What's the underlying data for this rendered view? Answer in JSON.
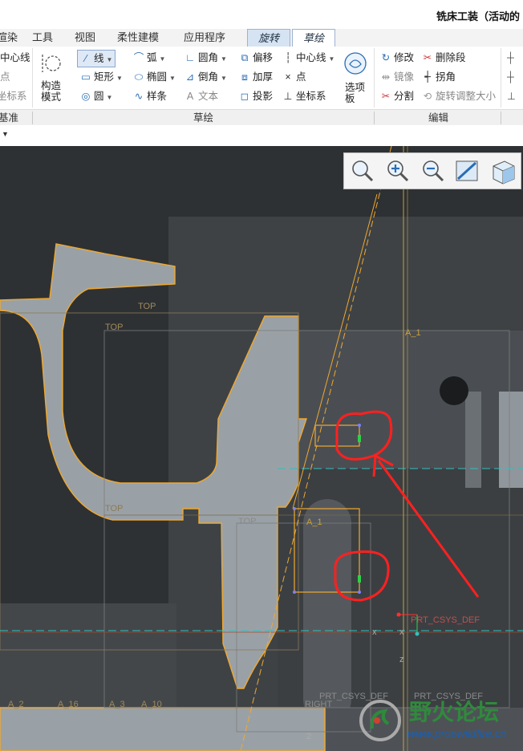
{
  "app": {
    "title": "铣床工装（活动的"
  },
  "tabs": [
    {
      "label": "渲染"
    },
    {
      "label": "工具"
    },
    {
      "label": "视图"
    },
    {
      "label": "柔性建模"
    },
    {
      "label": "应用程序"
    },
    {
      "label": "旋转"
    },
    {
      "label": "草绘"
    }
  ],
  "ribbon": {
    "col0": [
      "中心线",
      "点",
      "坐标系"
    ],
    "construct": "构造\n模式",
    "line": "线",
    "rect": "矩形",
    "circle": "圆",
    "arc": "弧",
    "ellipse": "椭圆",
    "spline": "样条",
    "fillet": "圆角",
    "chamfer": "倒角",
    "text": "文本",
    "offset": "偏移",
    "thicken": "加厚",
    "project": "投影",
    "centerline": "中心线",
    "point": "点",
    "csys": "坐标系",
    "palette": "选项\n板",
    "modify": "修改",
    "delete_seg": "删除段",
    "mirror": "镜像",
    "corner": "拐角",
    "divide": "分割",
    "rotate_resize": "旋转调整大小"
  },
  "groups": {
    "g0": "基准",
    "sketch": "草绘",
    "edit": "编辑"
  },
  "viewport": {
    "labels": {
      "top1": "TOP",
      "top2": "TOP",
      "top3": "TOP",
      "top4": "TOP",
      "a1a": "A_1",
      "a1b": "A_1",
      "csys": "PRT_CSYS_DEF",
      "csys2": "PRT_CSYS_DEF",
      "csys3": "PRT_CSYS_DEF",
      "a2": "A_2",
      "a16": "A_16",
      "a3": "A_3",
      "a10": "A_10",
      "right": "RIGHT",
      "x1": "x",
      "x2": "x",
      "z": "z",
      "two": "2"
    }
  },
  "watermark": {
    "text": "野火论坛",
    "url": "www.proewildfire.cn"
  },
  "colors": {
    "sketch": "#f0a830",
    "axis": "#31c0c0",
    "annotation": "#ff2020",
    "accent": "#2a6db5"
  }
}
